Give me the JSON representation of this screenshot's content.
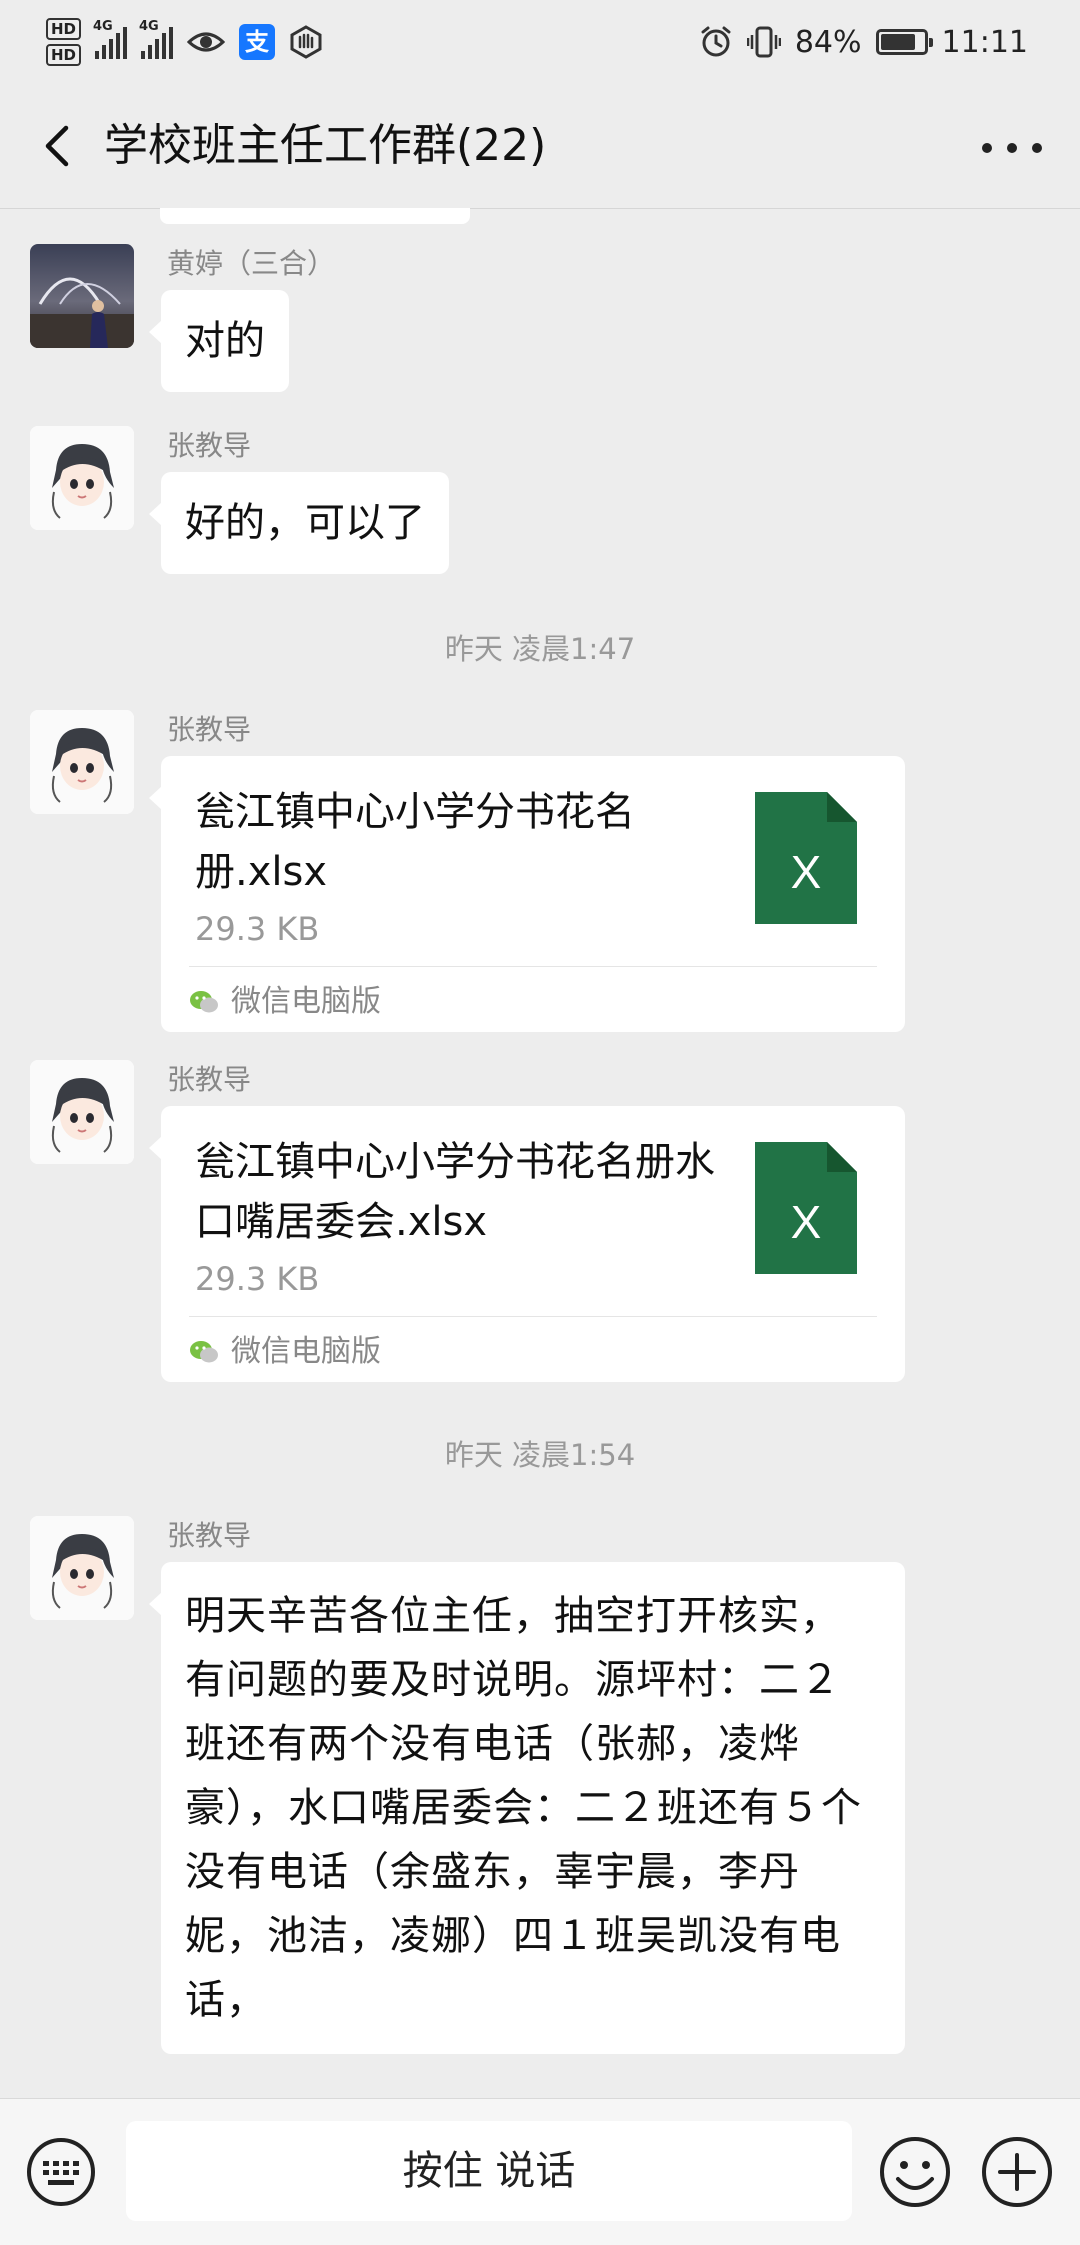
{
  "status_bar": {
    "hd1": "HD",
    "hd2": "HD",
    "net1": "4G",
    "net2": "4G",
    "battery_pct": "84%",
    "battery_level": 0.84,
    "time": "11:11",
    "icons": [
      "eye-comfort-icon",
      "alipay-icon",
      "hand-icon",
      "alarm-icon",
      "vibrate-icon",
      "battery-icon"
    ]
  },
  "header": {
    "title": "学校班主任工作群(22)"
  },
  "messages": [
    {
      "sender": "黄婷（三合）",
      "text": "对的"
    },
    {
      "sender": "张教导",
      "text": "好的，可以了"
    },
    {
      "timestamp": "昨天 凌晨1:47"
    },
    {
      "sender": "张教导",
      "file_name": "瓮江镇中心小学分书花名册.xlsx",
      "file_size": "29.3 KB",
      "source": "微信电脑版",
      "file_icon_letter": "X"
    },
    {
      "sender": "张教导",
      "file_name": "瓮江镇中心小学分书花名册水口嘴居委会.xlsx",
      "file_size": "29.3 KB",
      "source": "微信电脑版",
      "file_icon_letter": "X"
    },
    {
      "timestamp": "昨天 凌晨1:54"
    },
    {
      "sender": "张教导",
      "text": "明天辛苦各位主任，抽空打开核实，有问题的要及时说明。源坪村：二２班还有两个没有电话（张郝，凌烨豪），水口嘴居委会：二２班还有５个没有电话（余盛东，辜宇晨，李丹妮，池洁，凌娜）四１班吴凯没有电话，"
    }
  ],
  "input_bar": {
    "hold_to_talk": "按住 说话"
  },
  "colors": {
    "background": "#ededed",
    "bubble": "#ffffff",
    "excel_green": "#217346",
    "wechat_green": "#07c160"
  }
}
